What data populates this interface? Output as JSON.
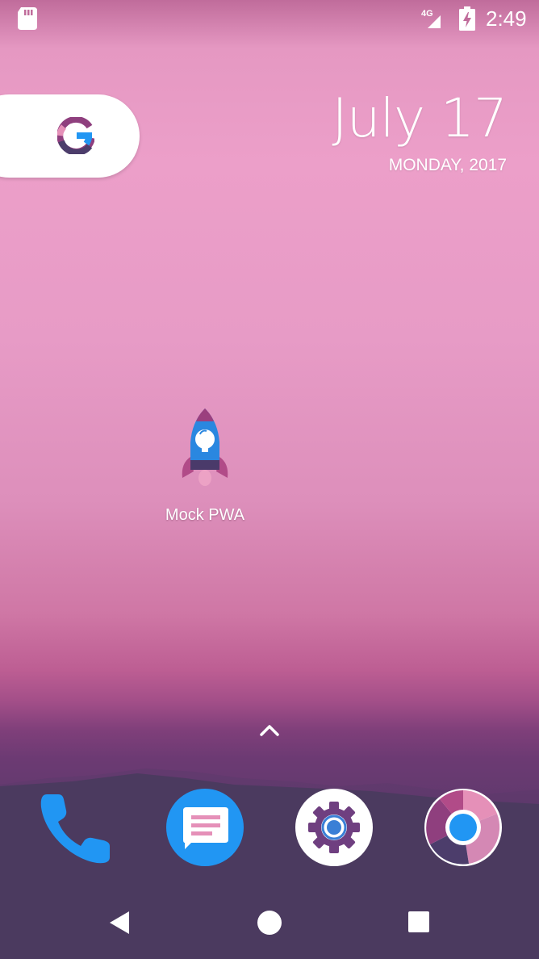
{
  "status_bar": {
    "network_label": "4G",
    "time": "2:49",
    "icons": [
      "sd-card-icon",
      "signal-icon",
      "battery-charging-icon"
    ]
  },
  "search_widget": {
    "icon": "google-g-icon"
  },
  "date_widget": {
    "date": "July 17",
    "weekday_year": "MONDAY, 2017"
  },
  "home_apps": [
    {
      "label": "Mock PWA",
      "icon": "rocket-icon"
    }
  ],
  "app_drawer_handle": {
    "icon": "chevron-up-icon"
  },
  "dock": [
    {
      "icon": "phone-icon",
      "color": "#2196f3"
    },
    {
      "icon": "messages-icon",
      "color": "#2196f3"
    },
    {
      "icon": "settings-icon",
      "color": "#ffffff"
    },
    {
      "icon": "chrome-icon",
      "color": "#ffffff"
    }
  ],
  "nav_bar": {
    "icons": [
      "back-icon",
      "home-icon",
      "recents-icon"
    ]
  },
  "colors": {
    "wallpaper_top": "#e598c2",
    "wallpaper_bottom": "#4b3a5f",
    "accent_blue": "#2196f3",
    "accent_purple": "#6f3f80"
  }
}
